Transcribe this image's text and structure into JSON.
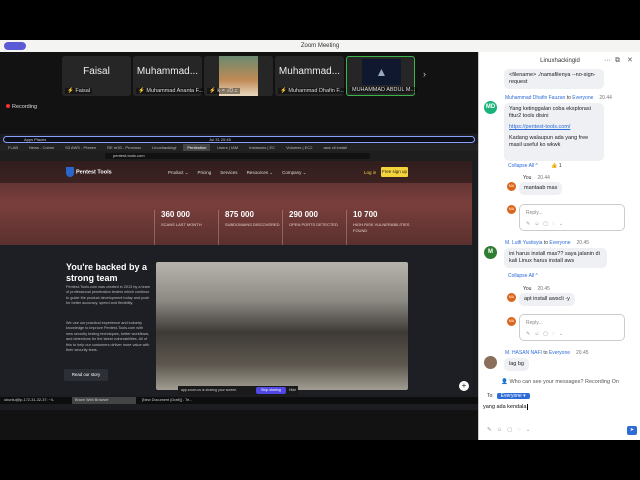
{
  "window": {
    "title": "Zoom Meeting"
  },
  "participants": [
    {
      "big": "Faisal",
      "name": "Faisal"
    },
    {
      "big": "Muhammad...",
      "name": "Muhammad Ananta F..."
    },
    {
      "big": "",
      "name": "k = √D.c"
    },
    {
      "big": "Muhammad...",
      "name": "Muhammad Dhafin F..."
    },
    {
      "big": "",
      "name": "MUHAMMAD ABDUL M..."
    }
  ],
  "recording": "Recording",
  "shared": {
    "panel": {
      "items": "Apps   Places",
      "clock": "Jul 31  20:45"
    },
    "tabs": [
      "FLAB",
      "News - Coinm",
      "S3 AWS - Presen",
      "RE re30 - Proxmox",
      "Linuxhackingi",
      "Pentestion",
      "Users | IAM",
      "Instances | EC",
      "Volumes | EC2",
      "aws cli install"
    ],
    "url": "pentest-tools.com",
    "site": {
      "logo": "Pentest Tools",
      "nav": [
        "Product ⌄",
        "Pricing",
        "Services",
        "Resources ⌄",
        "Company ⌄"
      ],
      "login": "Log in",
      "signup": "Free sign up",
      "stats": [
        {
          "value": "360 000",
          "label": "SCANS LAST MONTH"
        },
        {
          "value": "875 000",
          "label": "SUBDOMAINS DISCOVERED"
        },
        {
          "value": "290 000",
          "label": "OPEN PORTS DETECTED"
        },
        {
          "value": "10 700",
          "label": "HIGH RISK VULNERABILITIES FOUND"
        }
      ],
      "team_title": "You're backed by a strong team",
      "team_p1": "Pentest-Tools.com was created in 2013 by a team of professional penetration testers which continue to guide the product development today and push for better accuracy, speed and flexibility.",
      "team_p2": "We use our practical experience and industry knowledge to improve Pentest-Tools.com with new security testing techniques, better workflows, and detections for the latest vulnerabilities. All of this to help our customers deliver more value with their security tests.",
      "team_button": "Read our story"
    },
    "sharebar": {
      "text": "app.zoom.us is sharing your screen.",
      "stop": "Stop sharing",
      "hide": "Hide"
    },
    "taskbar": [
      "ubuntu@ip-172-31-32-37: ~/L",
      "Brave Web Browser",
      "[New Document (Draft)] - Te..."
    ]
  },
  "chat": {
    "title": "Linuxhackingid",
    "messages": {
      "prev": "<filename> ./namafilenya --no-sign-request",
      "m1": {
        "sender": "Muhammad Dhafin Fauzan",
        "to": "to",
        "target": "Everyone",
        "time": "20.44",
        "initials": "MD",
        "l1": "Yang ketinggalan coba eksplorasi fitur2 tools disini",
        "link": "https://pentest-tools.com/",
        "l2": "Kadang walaupun ada yang free masil useful ko wkwk",
        "collapse": "Collapse All ^",
        "reaction": "👍 1"
      },
      "r1": {
        "sender": "You",
        "time": "20.44",
        "text": "mantaab mas",
        "initials": "MA"
      },
      "m2": {
        "sender": "M. Lutfi Yustisyia",
        "to": "to",
        "target": "Everyone",
        "time": "20.45",
        "initials": "M",
        "text": "ini harus install mas?? saya jalanin di kali Linux harus install aws",
        "collapse": "Collapse All ^"
      },
      "r2": {
        "sender": "You",
        "time": "20.45",
        "text": "apt install awscli -y"
      },
      "m3": {
        "sender": "M. HASAN NAFI",
        "to": "to",
        "target": "Everyone",
        "time": "20.45",
        "text": "lag bg"
      }
    },
    "reply_placeholder": "Reply...",
    "notice": "Who can see your messages? Recording On",
    "to_label": "To:",
    "to_value": "Everyone ▾",
    "input_value": "yang ada kendala"
  },
  "colors": {
    "accent": "#2d6bd6",
    "zoom_purple": "#5b5bd6",
    "signup": "#f5d33a",
    "record": "#e33333"
  }
}
